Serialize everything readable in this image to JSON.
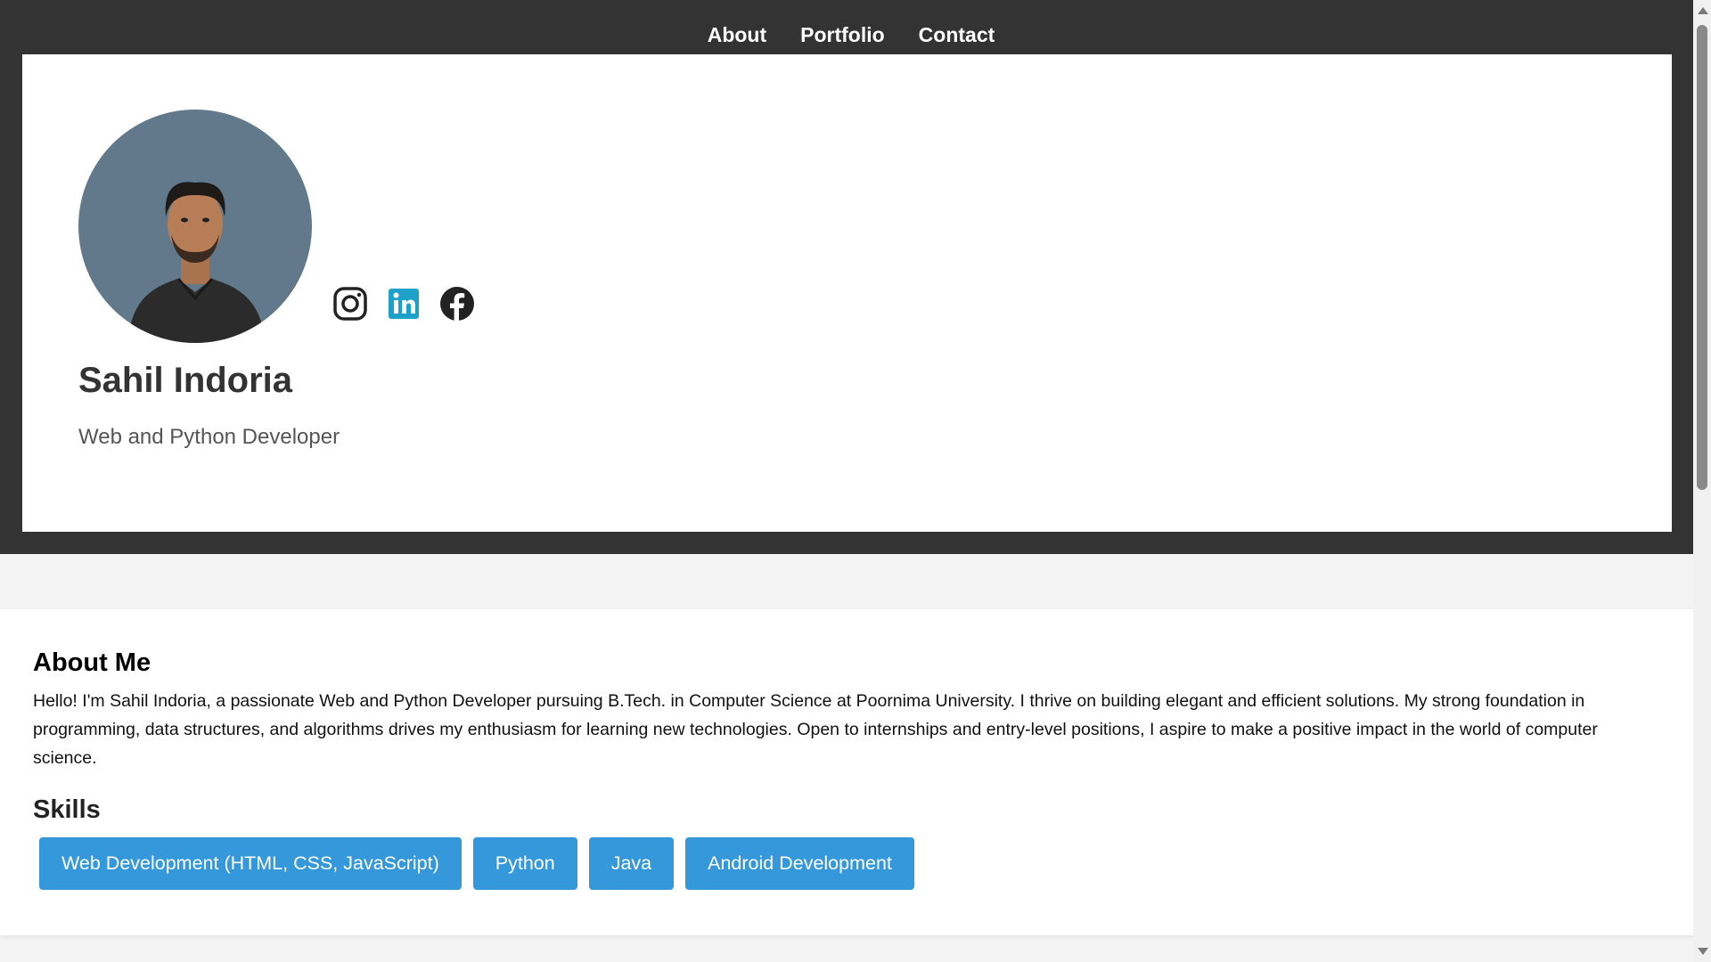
{
  "nav": {
    "items": [
      {
        "label": "About"
      },
      {
        "label": "Portfolio"
      },
      {
        "label": "Contact"
      }
    ]
  },
  "profile": {
    "name": "Sahil Indoria",
    "role": "Web and Python Developer",
    "avatar_icon": "profile-photo",
    "socials": [
      {
        "icon": "instagram-icon"
      },
      {
        "icon": "linkedin-icon"
      },
      {
        "icon": "facebook-icon"
      }
    ]
  },
  "about": {
    "heading": "About Me",
    "text": "Hello! I'm Sahil Indoria, a passionate Web and Python Developer pursuing B.Tech. in Computer Science at Poornima University. I thrive on building elegant and efficient solutions. My strong foundation in programming, data structures, and algorithms drives my enthusiasm for learning new technologies. Open to internships and entry-level positions, I aspire to make a positive impact in the world of computer science."
  },
  "skills": {
    "heading": "Skills",
    "items": [
      {
        "label": "Web Development (HTML, CSS, JavaScript)"
      },
      {
        "label": "Python"
      },
      {
        "label": "Java"
      },
      {
        "label": "Android Development"
      }
    ]
  },
  "colors": {
    "header_bg": "#333333",
    "card_bg": "#ffffff",
    "skill_bg": "#3498db",
    "avatar_bg": "#61798a",
    "linkedin": "#1da1c9"
  }
}
